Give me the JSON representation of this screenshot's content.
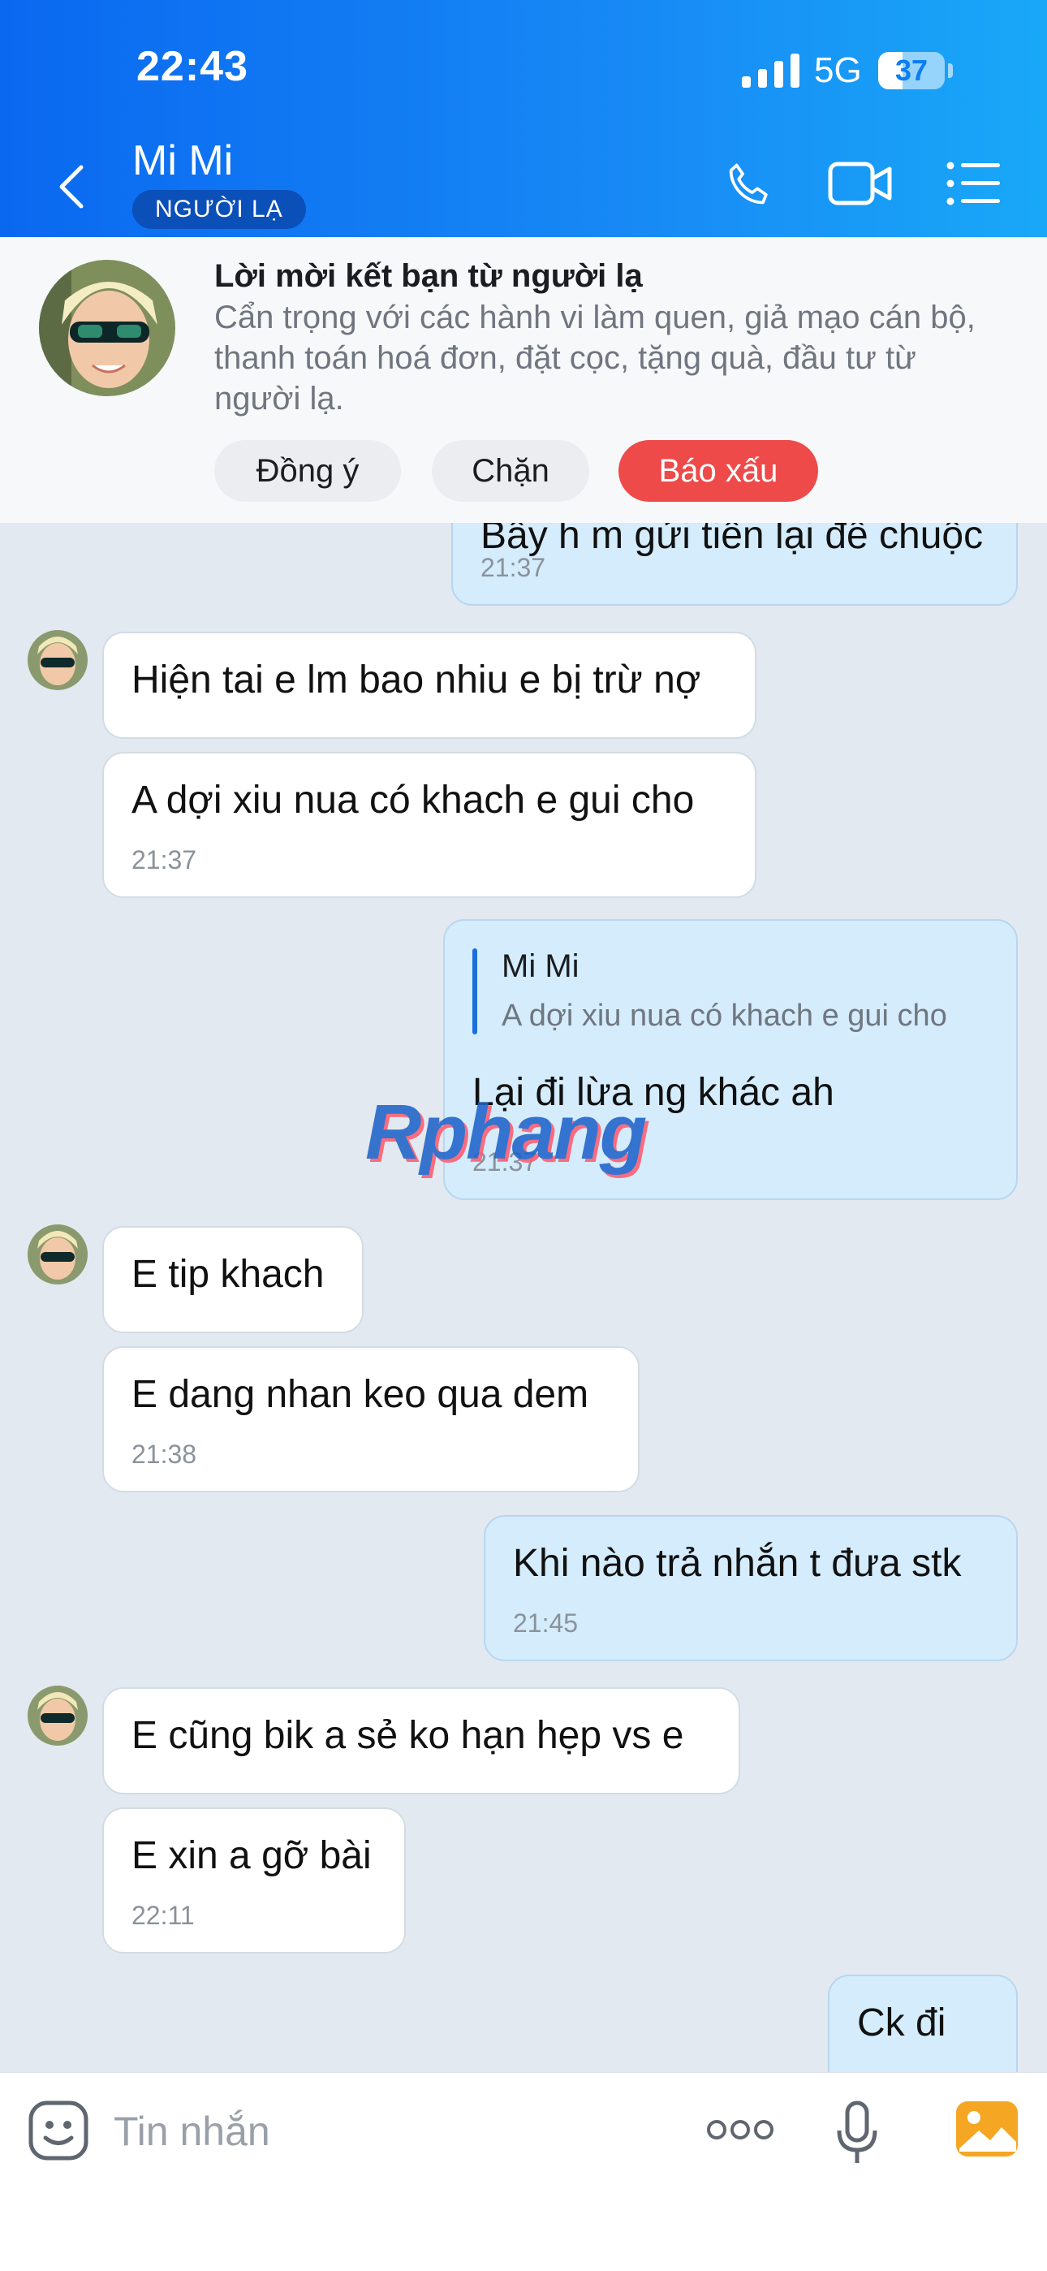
{
  "status_bar": {
    "time": "22:43",
    "network": "5G",
    "battery": "37",
    "battery_level": 0.37
  },
  "header": {
    "title": "Mi Mi",
    "badge": "NGƯỜI LẠ"
  },
  "banner": {
    "title": "Lời mời kết bạn từ người lạ",
    "text": "Cẩn trọng với các hành vi làm quen, giả mạo cán bộ, thanh toán hoá đơn, đặt cọc, tặng quà, đầu tư từ người lạ.",
    "accept": "Đồng ý",
    "block": "Chặn",
    "report": "Báo xấu"
  },
  "messages": [
    {
      "text": "Bây h m gửi tiền lại để chuộc",
      "time": "21:37"
    },
    {
      "text": "Hiện tai e lm bao nhiu e bị trừ nợ"
    },
    {
      "text": "A dợi xiu nua có khach e gui cho",
      "time": "21:37"
    },
    {
      "quote_name": "Mi Mi",
      "quote_text": "A dợi xiu nua có khach e gui cho",
      "text": "Lại đi lừa ng khác ah",
      "time": "21:37"
    },
    {
      "text": "E tip khach"
    },
    {
      "text": "E dang nhan keo qua dem",
      "time": "21:38"
    },
    {
      "text": "Khi nào trả nhắn t đưa stk",
      "time": "21:45"
    },
    {
      "text": "E cũng bik a sẻ ko hạn hẹp vs e"
    },
    {
      "text": "E xin a gỡ bài",
      "time": "22:11"
    },
    {
      "text": "Ck đi"
    }
  ],
  "watermark": "Rphang",
  "input": {
    "placeholder": "Tin nhắn"
  },
  "colors": {
    "header": "#1789f5",
    "report": "#ef4a4a",
    "outgoing": "#d4ecfc",
    "chat_bg": "#e2e9f1"
  }
}
